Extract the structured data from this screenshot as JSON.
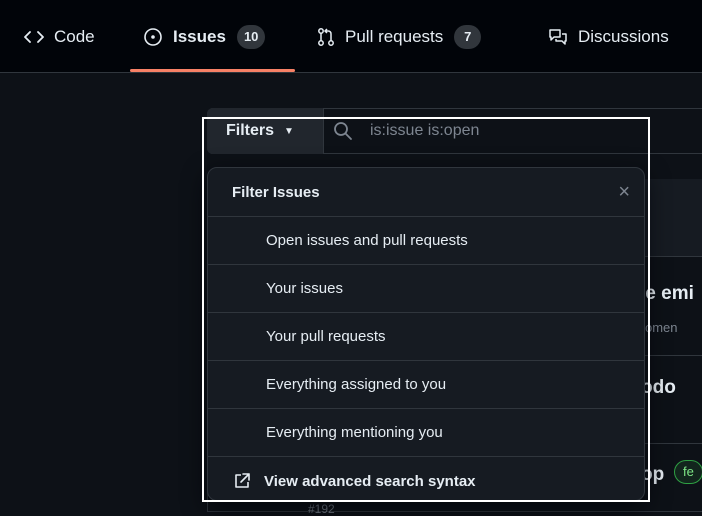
{
  "nav": {
    "tabs": [
      {
        "label": "Code",
        "icon": "code-icon"
      },
      {
        "label": "Issues",
        "icon": "issue-opened-icon",
        "count": "10",
        "selected": true
      },
      {
        "label": "Pull requests",
        "icon": "git-pull-request-icon",
        "count": "7"
      },
      {
        "label": "Discussions",
        "icon": "comment-discussion-icon"
      }
    ],
    "accent": "#f78166"
  },
  "search": {
    "filters_label": "Filters",
    "query": "is:issue is:open"
  },
  "background": {
    "title_1": "le emi",
    "meta_1": "omen",
    "title_2": "odo",
    "title_3": "op",
    "label_3": "fe",
    "bottom_meta": "#192"
  },
  "menu": {
    "title": "Filter Issues",
    "close": "×",
    "items": [
      "Open issues and pull requests",
      "Your issues",
      "Your pull requests",
      "Everything assigned to you",
      "Everything mentioning you"
    ],
    "advanced": "View advanced search syntax"
  }
}
